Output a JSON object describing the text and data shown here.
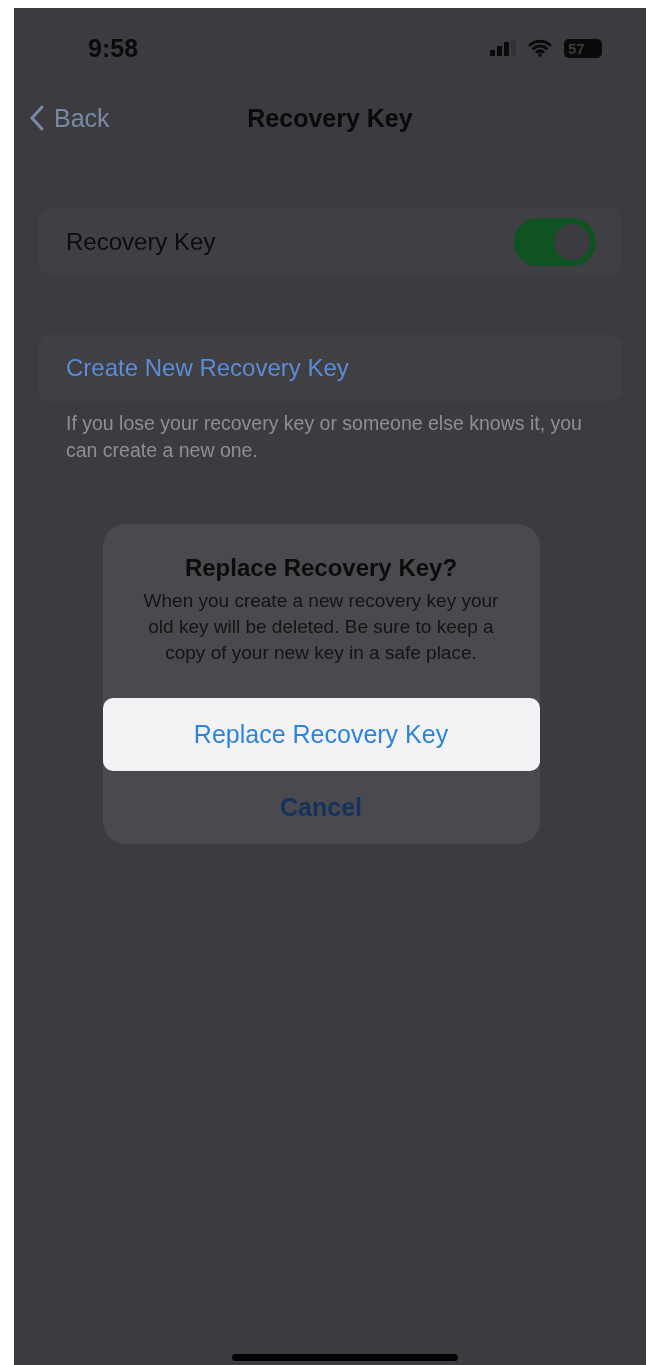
{
  "status_bar": {
    "time": "9:58",
    "battery": "57"
  },
  "nav": {
    "back": "Back",
    "title": "Recovery Key"
  },
  "settings": [
    {
      "kind": "toggle",
      "label": "Recovery Key",
      "on": true
    },
    {
      "kind": "link",
      "label": "Create New Recovery Key"
    }
  ],
  "footer": "If you lose your recovery key or someone else knows it, you can create a new one.",
  "alert": {
    "title": "Replace Recovery Key?",
    "message": "When you create a new recovery key your old key will be deleted. Be sure to keep a copy of your new key in a safe place.",
    "actions": [
      {
        "kind": "default",
        "label": "Replace Recovery Key",
        "selected": true
      },
      {
        "kind": "cancel",
        "label": "Cancel",
        "selected": false
      }
    ]
  }
}
